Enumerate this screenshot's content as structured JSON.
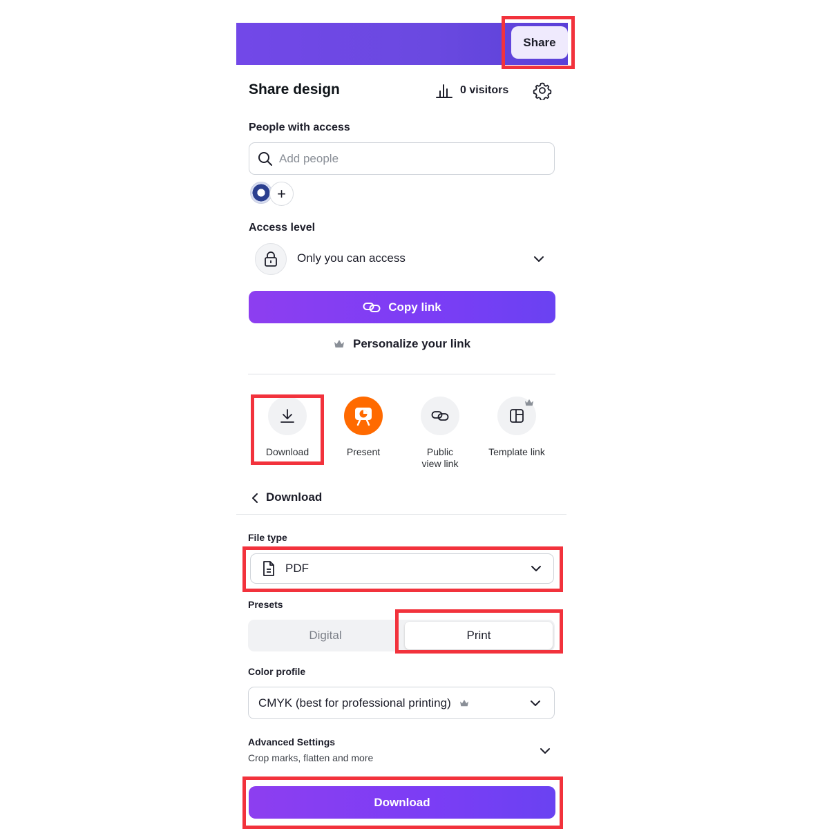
{
  "header": {
    "share_label": "Share"
  },
  "share_panel": {
    "title": "Share design",
    "visitors": "0 visitors",
    "people_label": "People with access",
    "add_people_placeholder": "Add people",
    "access_label": "Access level",
    "access_value": "Only you can access",
    "copy_link_label": "Copy link",
    "personalize_label": "Personalize your link",
    "options": [
      {
        "label": "Download",
        "icon": "download-icon"
      },
      {
        "label": "Present",
        "icon": "present-icon"
      },
      {
        "label_line1": "Public",
        "label_line2": "view link",
        "icon": "link-icon"
      },
      {
        "label": "Template link",
        "icon": "template-icon",
        "premium": true
      }
    ]
  },
  "download_panel": {
    "title": "Download",
    "file_type_label": "File type",
    "file_type_value": "PDF",
    "presets_label": "Presets",
    "presets": [
      "Digital",
      "Print"
    ],
    "selected_preset": "Print",
    "color_profile_label": "Color profile",
    "color_profile_value": "CMYK (best for professional printing)",
    "advanced_label": "Advanced Settings",
    "advanced_sub": "Crop marks, flatten and more",
    "download_button_label": "Download"
  },
  "colors": {
    "brand_purple": "#7b3df5",
    "highlight_red": "#f2323c",
    "present_orange": "#ff6a00"
  }
}
